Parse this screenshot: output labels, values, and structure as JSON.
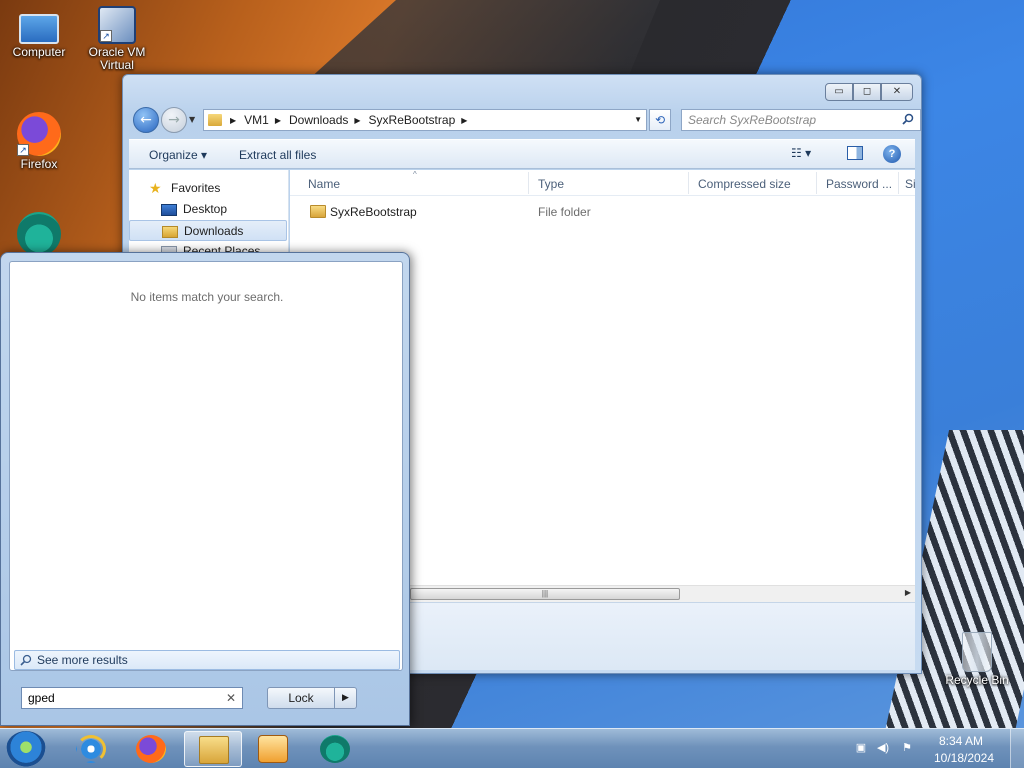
{
  "desktop": {
    "icons": [
      {
        "label": "Computer",
        "icon": "computer-icon"
      },
      {
        "label": "Oracle VM Virtual",
        "icon": "virtualbox-icon"
      },
      {
        "label": "Firefox",
        "icon": "firefox-icon"
      },
      {
        "label": "",
        "icon": "edge-icon"
      },
      {
        "label": "Recycle Bin",
        "icon": "recycle-bin-icon"
      }
    ]
  },
  "explorer": {
    "controls": {
      "minimize": "▭",
      "maximize": "◻",
      "close": "✕"
    },
    "address": {
      "segments": [
        "VM1",
        "Downloads",
        "SyxReBootstrap"
      ],
      "separator": "▶"
    },
    "search": {
      "placeholder": "Search SyxReBootstrap"
    },
    "toolbar": {
      "organize": "Organize ▾",
      "extract": "Extract all files",
      "views": "☷ ▾",
      "help": "?"
    },
    "nav": {
      "favorites": "Favorites",
      "desktop": "Desktop",
      "downloads": "Downloads",
      "recent": "Recent Places"
    },
    "columns": [
      "Name",
      "Type",
      "Compressed size",
      "Password ...",
      "Si"
    ],
    "rows": [
      {
        "name": "SyxReBootstrap",
        "type": "File folder"
      }
    ],
    "scroll_grip": "|||"
  },
  "startmenu": {
    "no_items": "No items match your search.",
    "see_more": "See more results",
    "search_value": "gped",
    "clear": "✕",
    "lock": "Lock",
    "lock_arrow": "▶"
  },
  "taskbar": {
    "apps": [
      {
        "name": "Internet Explorer",
        "icon": "ie-icon",
        "active": false
      },
      {
        "name": "Firefox",
        "icon": "firefox-icon",
        "active": false
      },
      {
        "name": "Windows Explorer",
        "icon": "explorer-icon",
        "active": true
      },
      {
        "name": "Windows Media Player",
        "icon": "media-player-icon",
        "active": false
      },
      {
        "name": "Microsoft Edge",
        "icon": "edge-icon",
        "active": false
      }
    ],
    "tray": {
      "time": "8:34 AM",
      "date": "10/18/2024",
      "icons": [
        "network-icon",
        "volume-icon",
        "flag-icon"
      ]
    }
  }
}
